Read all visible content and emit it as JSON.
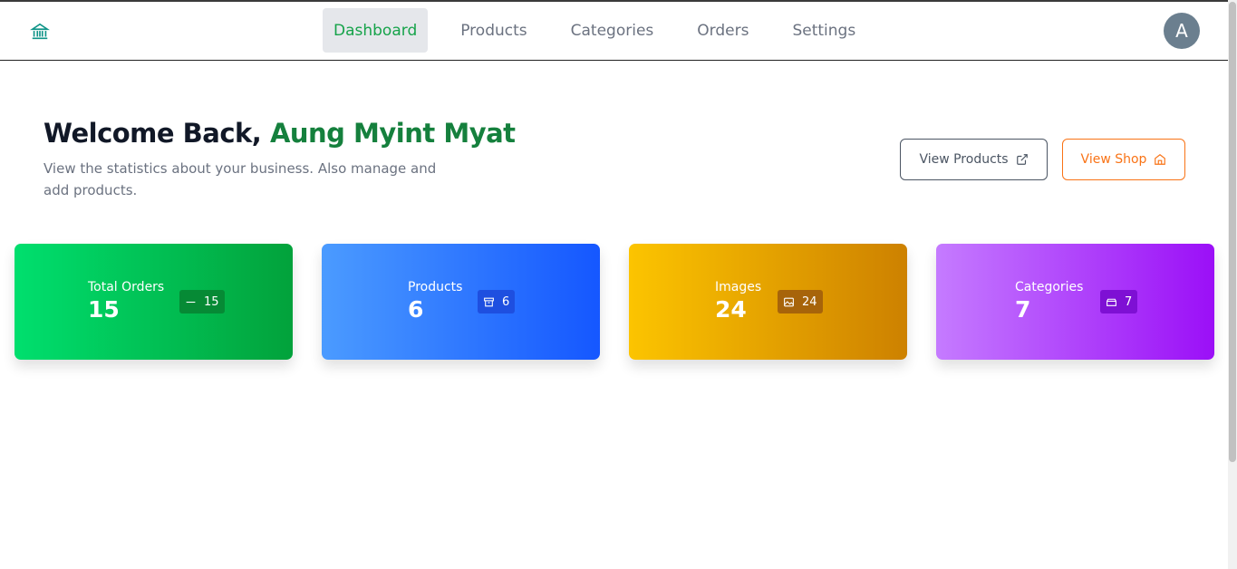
{
  "nav": {
    "logo_icon": "bank-icon",
    "items": [
      {
        "label": "Dashboard",
        "active": true
      },
      {
        "label": "Products",
        "active": false
      },
      {
        "label": "Categories",
        "active": false
      },
      {
        "label": "Orders",
        "active": false
      },
      {
        "label": "Settings",
        "active": false
      }
    ],
    "avatar_initial": "A"
  },
  "header": {
    "greeting": "Welcome Back,",
    "user_name": "Aung Myint Myat",
    "subtitle": "View the statistics about your business. Also manage and add products."
  },
  "actions": {
    "view_products": {
      "label": "View Products",
      "icon": "external-link-icon"
    },
    "view_shop": {
      "label": "View Shop",
      "icon": "home-icon"
    }
  },
  "stats": [
    {
      "label": "Total Orders",
      "value": "15",
      "badge": "15",
      "icon": "dash-icon"
    },
    {
      "label": "Products",
      "value": "6",
      "badge": "6",
      "icon": "archive-box-icon"
    },
    {
      "label": "Images",
      "value": "24",
      "badge": "24",
      "icon": "image-icon"
    },
    {
      "label": "Categories",
      "value": "7",
      "badge": "7",
      "icon": "folder-icon"
    }
  ],
  "colors": {
    "accent_green": "#15803d",
    "orange": "#f97316"
  }
}
